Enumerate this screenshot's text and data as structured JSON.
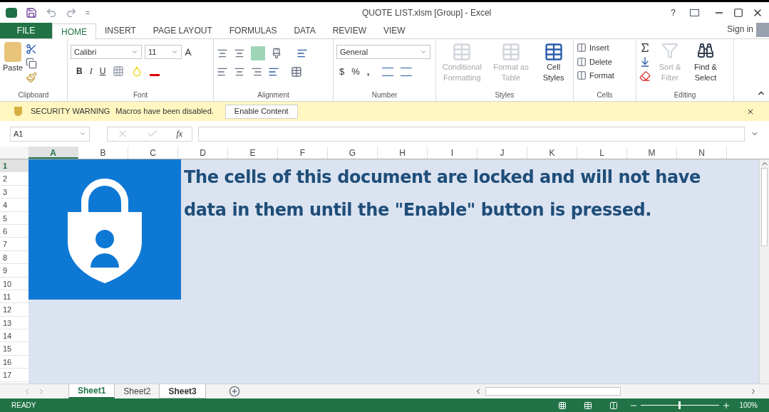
{
  "window": {
    "title": "QUOTE LIST.xlsm  [Group] - Excel",
    "help": "?"
  },
  "quick_access": {
    "separator": "="
  },
  "tabs": [
    {
      "label": "FILE",
      "kind": "file",
      "selected": false
    },
    {
      "label": "HOME",
      "kind": "tab",
      "selected": true
    },
    {
      "label": "INSERT",
      "kind": "tab",
      "selected": false
    },
    {
      "label": "PAGE LAYOUT",
      "kind": "tab",
      "selected": false
    },
    {
      "label": "FORMULAS",
      "kind": "tab",
      "selected": false
    },
    {
      "label": "DATA",
      "kind": "tab",
      "selected": false
    },
    {
      "label": "REVIEW",
      "kind": "tab",
      "selected": false
    },
    {
      "label": "VIEW",
      "kind": "tab",
      "selected": false
    }
  ],
  "sign_in": "Sign in",
  "ribbon": {
    "clipboard": {
      "label": "Clipboard",
      "paste": "Paste"
    },
    "font": {
      "label": "Font",
      "name": "Calibri",
      "size": "11",
      "bold": "B",
      "italic": "I",
      "underline": "U"
    },
    "alignment": {
      "label": "Alignment"
    },
    "number": {
      "label": "Number",
      "format": "General",
      "currency": "$",
      "percent": "%",
      "comma": ","
    },
    "styles": {
      "label": "Styles",
      "items": [
        {
          "label": "Conditional Formatting",
          "enabled": false
        },
        {
          "label": "Format as Table",
          "enabled": false
        },
        {
          "label": "Cell Styles",
          "enabled": true
        }
      ]
    },
    "cells": {
      "label": "Cells",
      "items": [
        "Insert",
        "Delete",
        "Format"
      ]
    },
    "editing": {
      "label": "Editing",
      "items": [
        {
          "label": "Sort & Filter",
          "enabled": false
        },
        {
          "label": "Find & Select",
          "enabled": true
        }
      ]
    }
  },
  "security_bar": {
    "title": "SECURITY WARNING",
    "message": "Macros have been disabled.",
    "button": "Enable Content"
  },
  "formula_bar": {
    "name_box": "A1",
    "fx": "fx"
  },
  "columns": [
    {
      "label": "A",
      "selected": true
    },
    {
      "label": "B",
      "selected": false
    },
    {
      "label": "C",
      "selected": false
    },
    {
      "label": "D",
      "selected": false
    },
    {
      "label": "E",
      "selected": false
    },
    {
      "label": "F",
      "selected": false
    },
    {
      "label": "G",
      "selected": false
    },
    {
      "label": "H",
      "selected": false
    },
    {
      "label": "I",
      "selected": false
    },
    {
      "label": "J",
      "selected": false
    },
    {
      "label": "K",
      "selected": false
    },
    {
      "label": "L",
      "selected": false
    },
    {
      "label": "M",
      "selected": false
    },
    {
      "label": "N",
      "selected": false
    }
  ],
  "rows": [
    {
      "label": "1",
      "selected": true
    },
    {
      "label": "2",
      "selected": false
    },
    {
      "label": "3",
      "selected": false
    },
    {
      "label": "4",
      "selected": false
    },
    {
      "label": "5",
      "selected": false
    },
    {
      "label": "6",
      "selected": false
    },
    {
      "label": "7",
      "selected": false
    },
    {
      "label": "8",
      "selected": false
    },
    {
      "label": "9",
      "selected": false
    },
    {
      "label": "10",
      "selected": false
    },
    {
      "label": "11",
      "selected": false
    },
    {
      "label": "12",
      "selected": false
    },
    {
      "label": "13",
      "selected": false
    },
    {
      "label": "14",
      "selected": false
    },
    {
      "label": "15",
      "selected": false
    },
    {
      "label": "16",
      "selected": false
    },
    {
      "label": "17",
      "selected": false
    }
  ],
  "sheet_message": "The cells of this document are locked and will not have data in them until the \"Enable\" button is pressed.",
  "sheets": [
    {
      "label": "Sheet1",
      "selected": true,
      "active": true
    },
    {
      "label": "Sheet2",
      "selected": false,
      "active": false
    },
    {
      "label": "Sheet3",
      "selected": true,
      "active": false
    }
  ],
  "status_bar": {
    "status": "READY",
    "zoom": "100%",
    "level": 0.5
  }
}
